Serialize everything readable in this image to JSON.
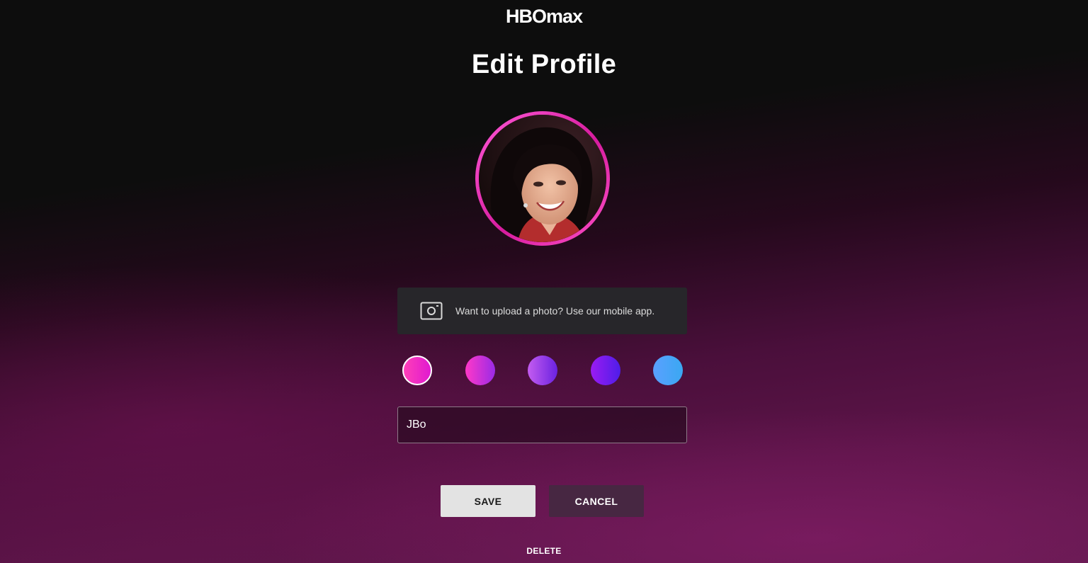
{
  "header": {
    "logo_text": "HBOmax"
  },
  "page": {
    "title": "Edit Profile"
  },
  "avatar": {
    "icon": "profile-photo",
    "ring_color": "#e52bb8"
  },
  "upload_note": {
    "icon": "camera-icon",
    "text": "Want to upload a photo? Use our mobile app."
  },
  "color_swatches": [
    {
      "name": "pink",
      "gradient": [
        "#ff3fb8",
        "#e01ad0"
      ],
      "selected": true
    },
    {
      "name": "magenta-purple",
      "gradient": [
        "#ff38c8",
        "#9a2be6"
      ],
      "selected": false
    },
    {
      "name": "violet",
      "gradient": [
        "#c45cf0",
        "#6a22e0"
      ],
      "selected": false
    },
    {
      "name": "purple-blue",
      "gradient": [
        "#9b1cf2",
        "#4e1de8"
      ],
      "selected": false
    },
    {
      "name": "blue",
      "gradient": [
        "#5aa0ff",
        "#3aa8f2"
      ],
      "selected": false
    }
  ],
  "name_field": {
    "value": "JBo"
  },
  "actions": {
    "save_label": "SAVE",
    "cancel_label": "CANCEL",
    "delete_label": "DELETE"
  },
  "colors": {
    "background_top": "#0d0d0d",
    "background_bottom": "#611a4d",
    "save_button": "#e3e3e3",
    "cancel_button": "#472742"
  }
}
